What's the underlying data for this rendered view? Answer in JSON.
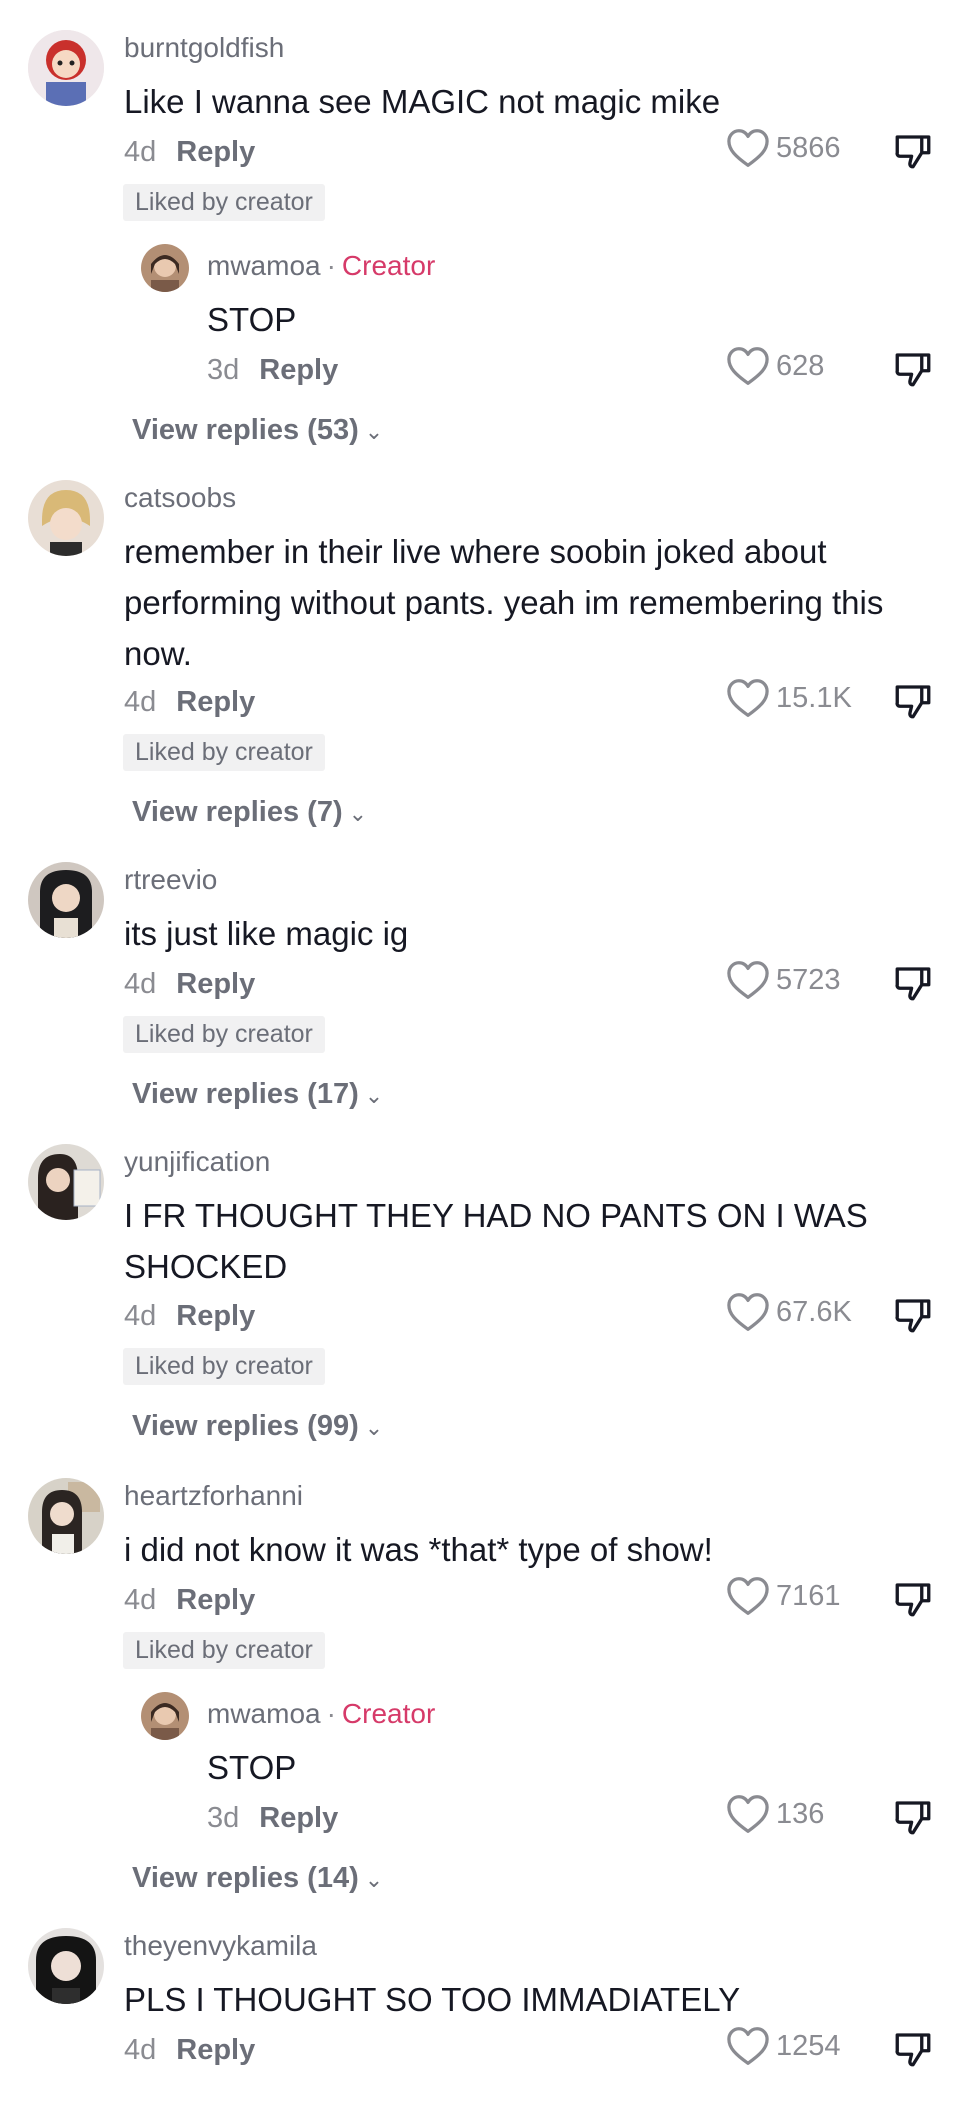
{
  "colors": {
    "creator": "#d63a69",
    "muted": "#8a8b91",
    "text": "#161823",
    "badge_bg": "#f1f1f2"
  },
  "icons": {
    "like": "heart-outline-icon",
    "dislike": "thumbs-down-icon",
    "expand": "chevron-down-icon"
  },
  "labels": {
    "reply": "Reply",
    "liked_by_creator": "Liked by creator",
    "creator": "Creator"
  },
  "comments": [
    {
      "username": "burntgoldfish",
      "text": "Like I wanna see MAGIC not magic mike",
      "age": "4d",
      "likes": "5866",
      "liked_by_creator": true,
      "reply": {
        "username": "mwamoa",
        "text": "STOP",
        "age": "3d",
        "likes": "628"
      },
      "view_replies": "View replies (53)"
    },
    {
      "username": "catsoobs",
      "text": "remember in their live where soobin joked about performing without pants. yeah im remembering this now.",
      "age": "4d",
      "likes": "15.1K",
      "liked_by_creator": true,
      "view_replies": "View replies (7)"
    },
    {
      "username": "rtreevio",
      "text": "its just like magic ig",
      "age": "4d",
      "likes": "5723",
      "liked_by_creator": true,
      "view_replies": "View replies (17)"
    },
    {
      "username": "yunjification",
      "text": "I FR THOUGHT THEY HAD NO PANTS ON I WAS SHOCKED",
      "age": "4d",
      "likes": "67.6K",
      "liked_by_creator": true,
      "view_replies": "View replies (99)"
    },
    {
      "username": "heartzforhanni",
      "text": "i did not know it was *that* type of show!",
      "age": "4d",
      "likes": "7161",
      "liked_by_creator": true,
      "reply": {
        "username": "mwamoa",
        "text": "STOP",
        "age": "3d",
        "likes": "136"
      },
      "view_replies": "View replies (14)"
    },
    {
      "username": "theyenvykamila",
      "text": "PLS I THOUGHT SO TOO IMMADIATELY",
      "age": "4d",
      "likes": "1254",
      "liked_by_creator": false
    }
  ]
}
